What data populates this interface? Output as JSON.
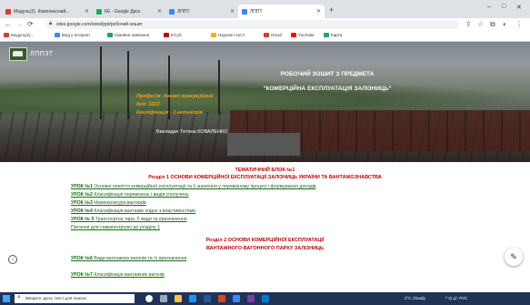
{
  "browser": {
    "tabs": [
      {
        "label": "Модуль(2). Комплексний...",
        "icon_color": "#d23f31"
      },
      {
        "label": "КЕ - Google Диск",
        "icon_color": "#1fa463"
      },
      {
        "label": "ЛППТ",
        "icon_color": "#4285f4"
      },
      {
        "label": "ЛППТ",
        "icon_color": "#4285f4"
      }
    ],
    "new_tab": "+",
    "window_controls": [
      "–",
      "□",
      "✕"
    ],
    "url": "sites.google.com/view/lppt/робочий-зошит",
    "bookmarks": [
      {
        "label": "Модуль(2)...",
        "icon_color": "#d23f31"
      },
      {
        "label": "Вхід у Інтернет",
        "icon_color": "#4285f4"
      },
      {
        "label": "Сімейне навчання",
        "icon_color": "#1fa463"
      },
      {
        "label": "Ютуб",
        "icon_color": "#c00000"
      },
      {
        "label": "Наукові статті",
        "icon_color": "#f4b400"
      },
      {
        "label": "Gmail",
        "icon_color": "#d23f31"
      },
      {
        "label": "YouTube",
        "icon_color": "#ff0000"
      },
      {
        "label": "Карти",
        "icon_color": "#1fa463"
      }
    ]
  },
  "site": {
    "name": "ЛППЗТ",
    "title": "РОБОЧИЙ ЗОШИТ З ПРЕДМЕТА",
    "subtitle": "\"КОМЕРЦІЙНА ЕКСПЛУАТАЦІЯ ЗАЛІЗНИЦЬ\"",
    "profession": "Професія: Агент комерційний",
    "code": "Код: 3222",
    "qualification": "Кваліфікація - 2 категорія",
    "teacher": "Викладач Тетяна КОВАЛЕНКО"
  },
  "content": {
    "block1_title": "ТЕМАТИЧНИЙ БЛОК №1",
    "section1_title": "Розділ 1 ОСНОВИ КОМЕРЦІЙНОЇ ЕКСПЛУАТАЦІЇ ЗАЛІЗНИЦЬ УКРАЇНИ ТА ВАНТАЖОЗНАВСТВА",
    "lessons1": [
      {
        "num": "УРОК №1",
        "text": "Основні поняття комерційної експлуатації та її значення у перевізному процесі і формування доходів"
      },
      {
        "num": "УРОК №2",
        "text": "Класифікація перевезень і видів сполучень"
      },
      {
        "num": "УРОК №3",
        "text": "Номенклатура вантажів"
      },
      {
        "num": "УРОК №4",
        "text": "Класифікація вантажів згідно з властивостями"
      },
      {
        "num": "УРОК № 5",
        "text": "Транспортна тара. Її види та призначення"
      }
    ],
    "self_control1": "Питання для самоконтролю до розділу 1",
    "section2_title_line1": "Розділ 2 ОСНОВИ КОМЕРЦІЙНОЇ ЕКСПЛУАТАЦІЇ",
    "section2_title_line2": "ВАНТАЖНОГО ВАГОННОГО ПАРКУ ЗАЛІЗНИЦЬ",
    "lessons2": [
      {
        "num": "УРОК №6",
        "text": "Види вантажних вагонів та їх призначення"
      },
      {
        "num": "УРОК №7",
        "text": "Класифікація вантажних вагонів"
      }
    ]
  },
  "taskbar": {
    "search_placeholder": "Введите здесь текст для поиска",
    "weather": "2°C Cloudy",
    "tray": "^ ⊡ 🔊 РУС"
  },
  "colors": {
    "accent_red": "#c00000",
    "link_green": "#1a6b1a",
    "hero_orange": "#f0a020"
  }
}
